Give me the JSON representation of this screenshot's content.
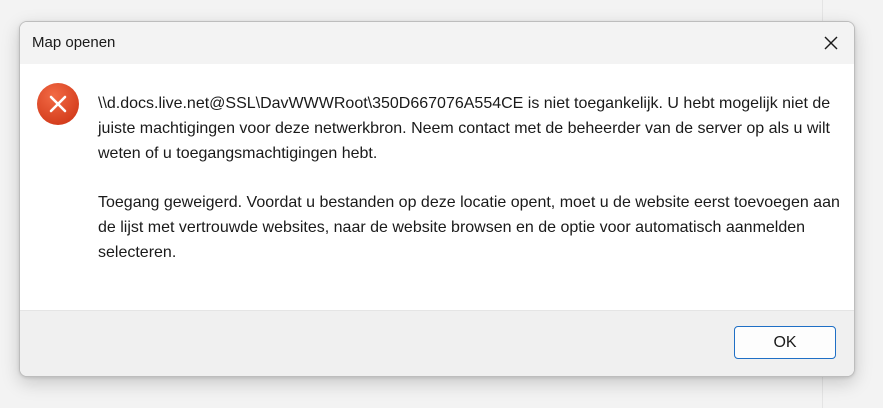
{
  "dialog": {
    "title": "Map openen",
    "icons": {
      "close": "close-icon",
      "error": "error-icon"
    },
    "message": {
      "paragraph1": "\\\\d.docs.live.net@SSL\\DavWWWRoot\\350D667076A554CE is niet toegankelijk. U hebt mogelijk niet de juiste machtigingen voor deze netwerkbron. Neem contact met de beheerder van de server op als u wilt weten of u toegangsmachtigingen hebt.",
      "paragraph2": "Toegang geweigerd. Voordat u bestanden op deze locatie opent, moet u de website eerst toevoegen aan de lijst met vertrouwde websites, naar de website browsen en de optie voor automatisch aanmelden selecteren."
    },
    "ok_label": "OK"
  },
  "colors": {
    "error_icon": "#e0462b",
    "ok_border": "#1f6fc5",
    "footer_bg": "#f0f0f0"
  }
}
